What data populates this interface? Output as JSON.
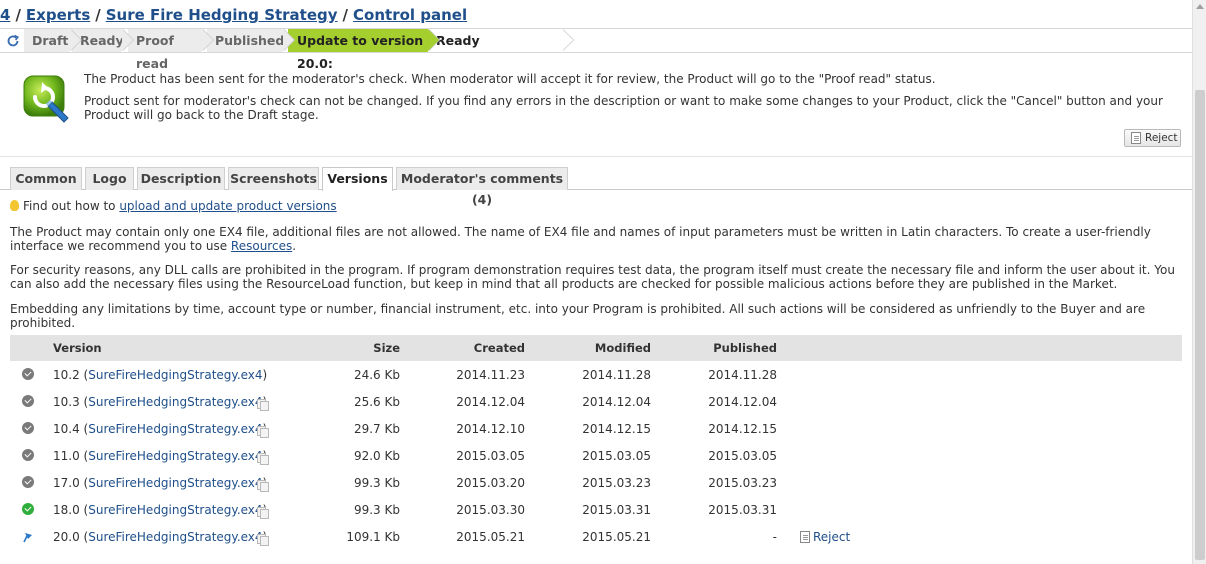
{
  "breadcrumb": {
    "items": [
      "4",
      "Experts",
      "Sure Fire Hedging Strategy",
      "Control panel"
    ],
    "separator": "/"
  },
  "status_steps": [
    {
      "label": "Draft",
      "state": "done"
    },
    {
      "label": "Ready",
      "state": "done"
    },
    {
      "label": "Proof read",
      "state": "done"
    },
    {
      "label": "Published",
      "state": "done"
    },
    {
      "label": "Update to version 20.0:",
      "state": "active"
    },
    {
      "label": "Ready",
      "state": "next"
    }
  ],
  "notice": {
    "line1": "The Product has been sent for the moderator's check. When moderator will accept it for review, the Product will go to the \"Proof read\" status.",
    "line2": "Product sent for moderator's check can not be changed. If you find any errors in the description or want to make some changes to your Product, click the \"Cancel\" button and your Product will go back to the Draft stage.",
    "reject_label": "Reject"
  },
  "tabs": [
    {
      "label": "Common",
      "active": false
    },
    {
      "label": "Logo",
      "active": false
    },
    {
      "label": "Description",
      "active": false
    },
    {
      "label": "Screenshots",
      "active": false
    },
    {
      "label": "Versions",
      "active": true
    },
    {
      "label": "Moderator's comments (4)",
      "active": false
    }
  ],
  "content": {
    "hint_prefix": "Find out how to ",
    "hint_link": "upload and update product versions",
    "para1_text": "The Product may contain only one EX4 file, additional files are not allowed. The name of EX4 file and names of input parameters must be written in Latin characters. To create a user-friendly interface we recommend you to use ",
    "para1_link": "Resources",
    "para1_end": ".",
    "para2": "For security reasons, any DLL calls are prohibited in the program. If program demonstration requires test data, the program itself must create the necessary file and inform the user about it. You can also add the necessary files using the ResourceLoad function, but keep in mind that all products are checked for possible malicious actions before they are published in the Market.",
    "para3": "Embedding any limitations by time, account type or number, financial instrument, etc. into your Program is prohibited. All such actions will be considered as unfriendly to the Buyer and are prohibited."
  },
  "table": {
    "headers": {
      "version": "Version",
      "size": "Size",
      "created": "Created",
      "modified": "Modified",
      "published": "Published"
    },
    "rows": [
      {
        "version": "10.2",
        "file": "SureFireHedgingStrategy.ex4",
        "size": "24.6 Kb",
        "created": "2014.11.23",
        "modified": "2014.11.28",
        "published": "2014.11.28",
        "status": "gray",
        "copy": false,
        "reject": ""
      },
      {
        "version": "10.3",
        "file": "SureFireHedgingStrategy.ex4",
        "size": "25.6 Kb",
        "created": "2014.12.04",
        "modified": "2014.12.04",
        "published": "2014.12.04",
        "status": "gray",
        "copy": true,
        "reject": ""
      },
      {
        "version": "10.4",
        "file": "SureFireHedgingStrategy.ex4",
        "size": "29.7 Kb",
        "created": "2014.12.10",
        "modified": "2014.12.15",
        "published": "2014.12.15",
        "status": "gray",
        "copy": true,
        "reject": ""
      },
      {
        "version": "11.0",
        "file": "SureFireHedgingStrategy.ex4",
        "size": "92.0 Kb",
        "created": "2015.03.05",
        "modified": "2015.03.05",
        "published": "2015.03.05",
        "status": "gray",
        "copy": true,
        "reject": ""
      },
      {
        "version": "17.0",
        "file": "SureFireHedgingStrategy.ex4",
        "size": "99.3 Kb",
        "created": "2015.03.20",
        "modified": "2015.03.23",
        "published": "2015.03.23",
        "status": "gray",
        "copy": true,
        "reject": ""
      },
      {
        "version": "18.0",
        "file": "SureFireHedgingStrategy.ex4",
        "size": "99.3 Kb",
        "created": "2015.03.30",
        "modified": "2015.03.31",
        "published": "2015.03.31",
        "status": "green",
        "copy": true,
        "reject": ""
      },
      {
        "version": "20.0",
        "file": "SureFireHedgingStrategy.ex4",
        "size": "109.1 Kb",
        "created": "2015.05.21",
        "modified": "2015.05.21",
        "published": "-",
        "status": "pending",
        "copy": true,
        "reject": "Reject"
      }
    ]
  },
  "colors": {
    "active_step": "#a5cf2f",
    "link": "#1f4f8a",
    "status_ok": "#2fae3b"
  },
  "icons": {
    "refresh": "refresh-icon",
    "notice": "upload-product-icon",
    "hint": "lightbulb-icon",
    "reject": "document-icon"
  }
}
